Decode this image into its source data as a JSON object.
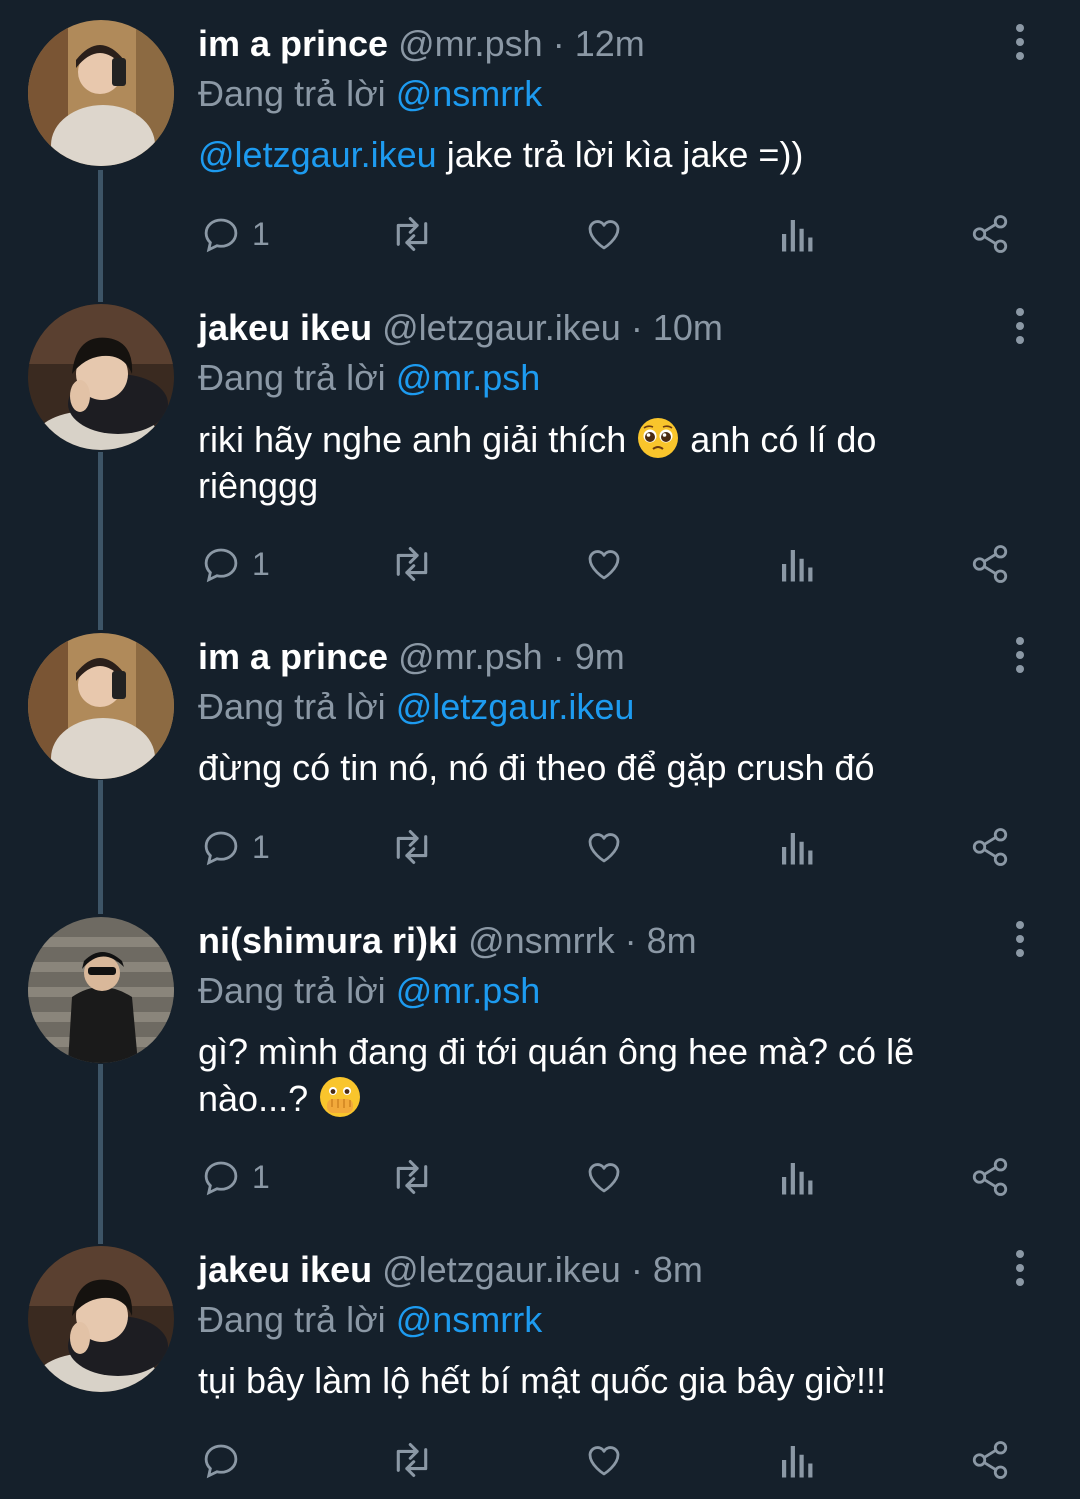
{
  "reply_prefix": "Đang trả lời",
  "tweets": [
    {
      "name": "im a prince",
      "handle": "@mr.psh",
      "dot": "·",
      "time": "12m",
      "reply_to": "@nsmrrk",
      "body_mention": "@letzgaur.ikeu",
      "body_text": " jake trả lời kìa jake =))",
      "reply_count": "1"
    },
    {
      "name": "jakeu ikeu",
      "handle": "@letzgaur.ikeu",
      "dot": "·",
      "time": "10m",
      "reply_to": "@mr.psh",
      "body_text": "riki hãy nghe anh giải thích ",
      "body_text_after": " anh có lí do riênggg",
      "emoji": "pleading-face",
      "reply_count": "1"
    },
    {
      "name": "im a prince",
      "handle": "@mr.psh",
      "dot": "·",
      "time": "9m",
      "reply_to": "@letzgaur.ikeu",
      "body_text": "đừng có tin nó, nó đi theo để gặp crush đó",
      "reply_count": "1"
    },
    {
      "name": "ni(shimura ri)ki",
      "handle": "@nsmrrk",
      "dot": "·",
      "time": "8m",
      "reply_to": "@mr.psh",
      "body_text": "gì? mình đang đi tới quán ông hee mà? có lẽ nào...? ",
      "emoji": "face-with-open-eyes-and-hand-over-mouth",
      "reply_count": "1"
    },
    {
      "name": "jakeu ikeu",
      "handle": "@letzgaur.ikeu",
      "dot": "·",
      "time": "8m",
      "reply_to": "@nsmrrk",
      "body_text": "tụi bây làm lộ hết bí mật quốc gia bây giờ!!!",
      "reply_count": ""
    }
  ],
  "colors": {
    "background": "#15202b",
    "text": "#ffffff",
    "muted": "#8b98a5",
    "link": "#1d9bf0",
    "thread_line": "#3d5466"
  }
}
